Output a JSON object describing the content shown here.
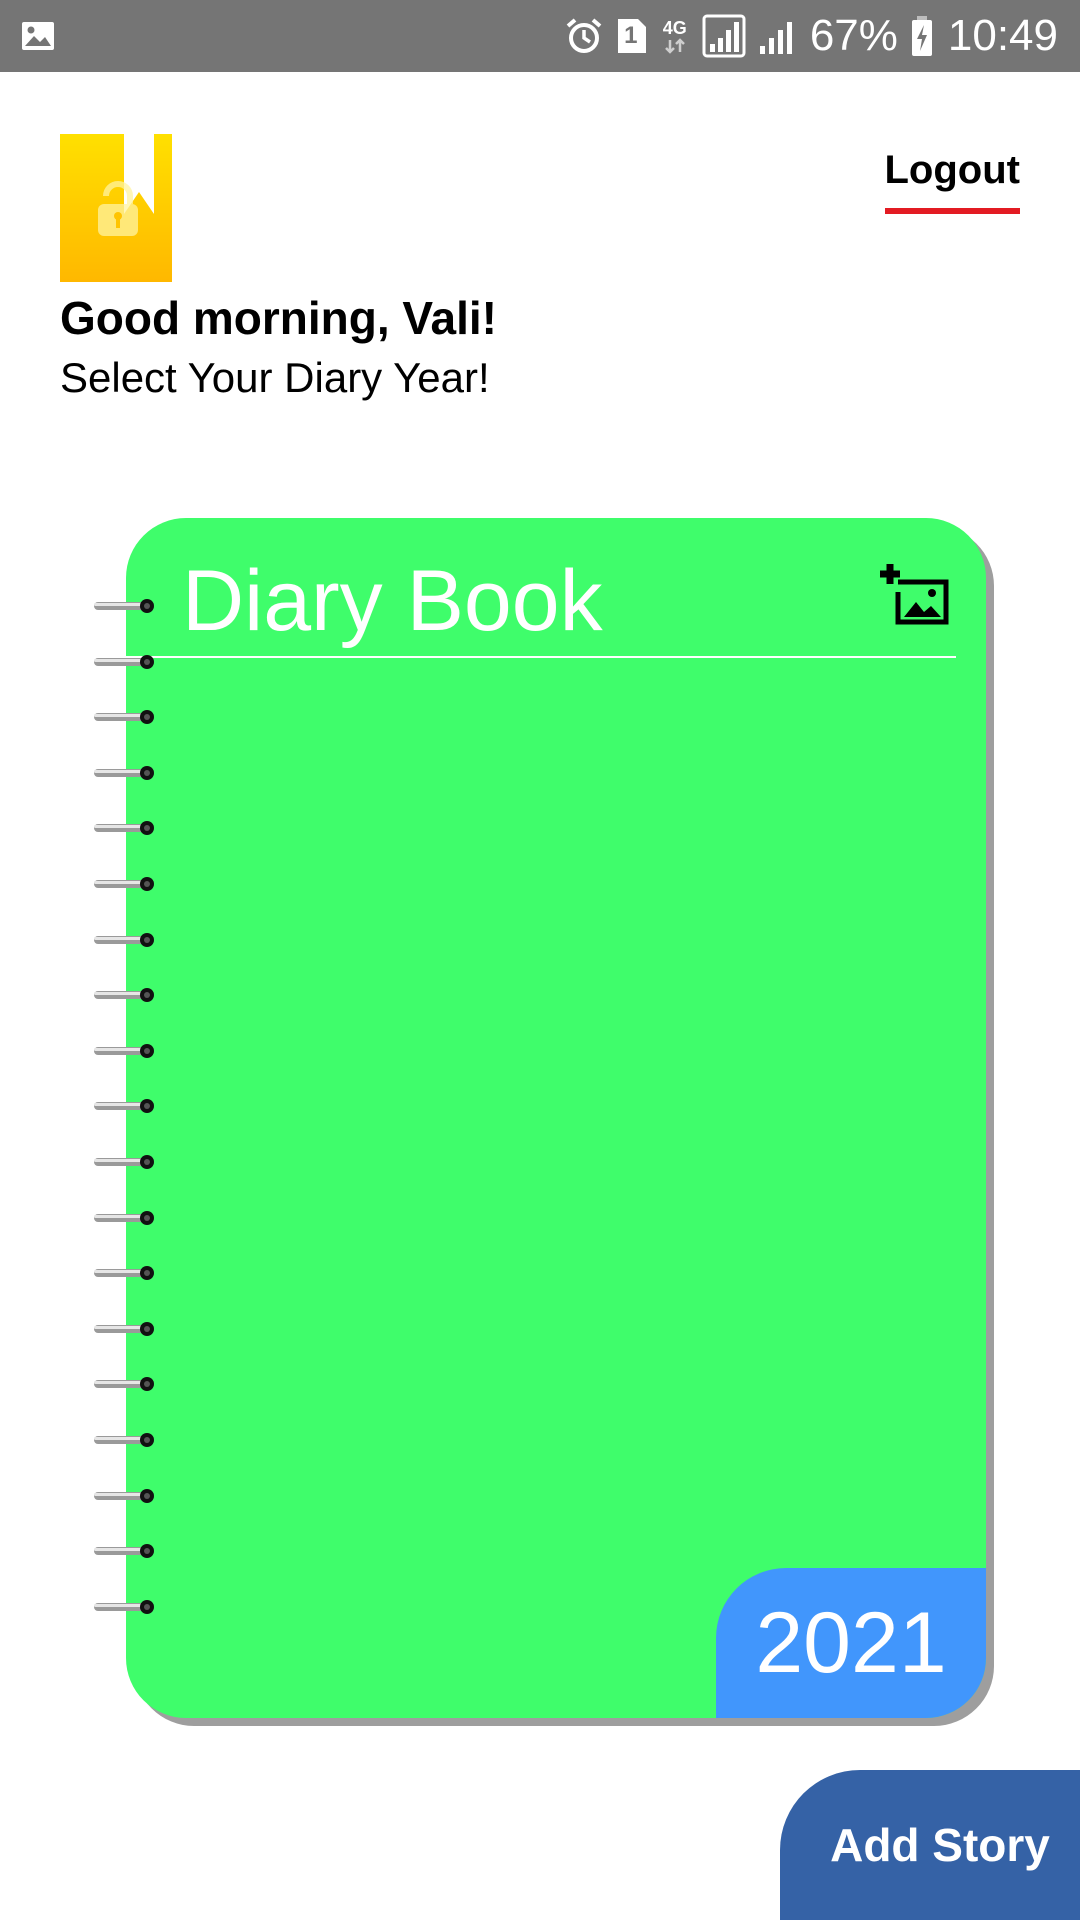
{
  "status_bar": {
    "battery": "67%",
    "time": "10:49",
    "sim_slot": "1",
    "network_type": "4G",
    "icons": [
      "image-icon",
      "alarm-icon",
      "sim-icon",
      "network-4g-icon",
      "signal-icon",
      "signal-icon",
      "battery-charging-icon"
    ]
  },
  "header": {
    "logo_icon": "diary-logo-icon",
    "logout_label": "Logout",
    "greeting": "Good morning, Vali!",
    "subtitle": "Select Your Diary Year!"
  },
  "diary": {
    "title": "Diary Book",
    "year": "2021",
    "add_image_icon": "add-image-icon",
    "ring_count": 19,
    "colors": {
      "cover": "#3ffd6b",
      "year_badge": "#4196fc"
    }
  },
  "fab": {
    "label": "Add Story",
    "color": "#3562a6"
  },
  "colors": {
    "status_bar": "#757575",
    "logout_underline": "#e31b23"
  }
}
